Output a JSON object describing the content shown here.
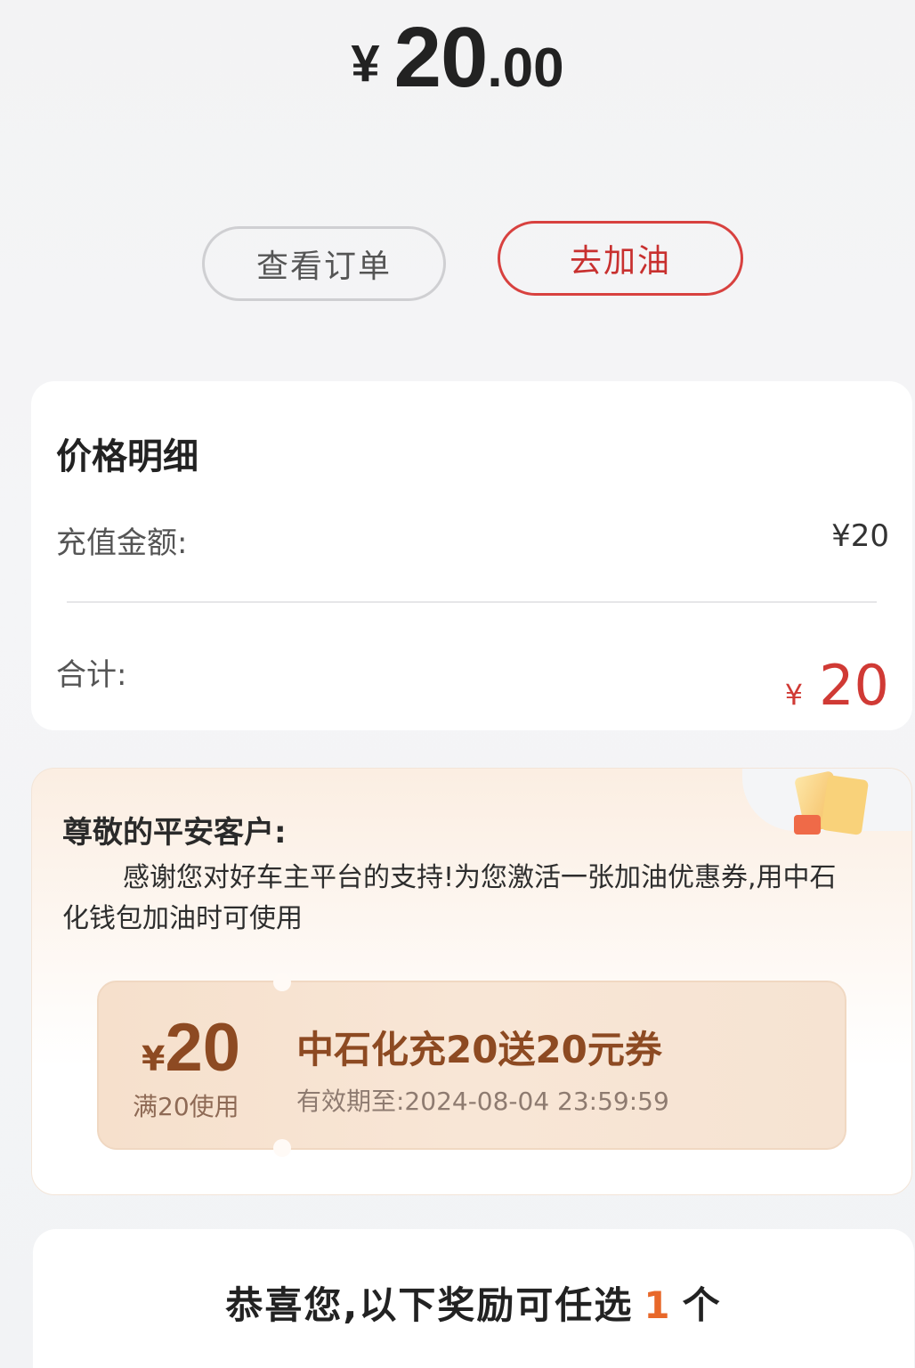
{
  "payment": {
    "currency": "¥",
    "amount_integer": "20",
    "amount_decimal": ".00"
  },
  "actions": {
    "view_orders": "查看订单",
    "go_refuel": "去加油"
  },
  "price_detail": {
    "title": "价格明细",
    "recharge_label": "充值金额:",
    "recharge_value": "¥20",
    "total_label": "合计:",
    "total_currency": "¥",
    "total_value": "20"
  },
  "promo": {
    "greeting": "尊敬的平安客户:",
    "message": "感谢您对好车主平台的支持!为您激活一张加油优惠券,用中石化钱包加油时可使用",
    "coupon": {
      "currency": "¥",
      "value": "20",
      "condition": "满20使用",
      "name": "中石化充20送20元券",
      "expiry": "有效期至:2024-08-04 23:59:59"
    }
  },
  "reward": {
    "prefix": "恭喜您,以下奖励可任选",
    "count": "1",
    "suffix": "个"
  }
}
